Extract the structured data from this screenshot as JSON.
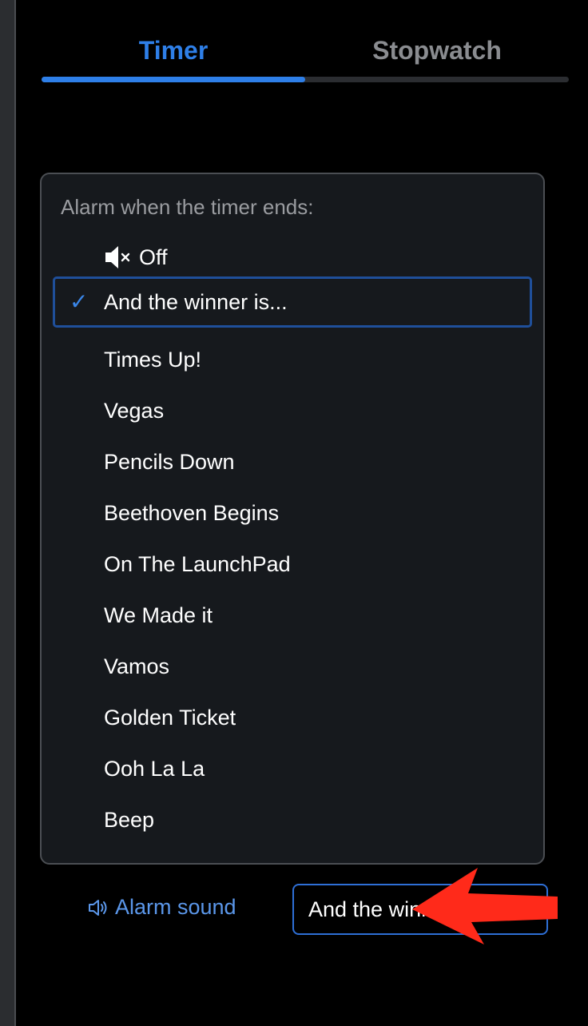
{
  "tabs": {
    "timer": "Timer",
    "stopwatch": "Stopwatch",
    "active": "timer"
  },
  "dropdown": {
    "label": "Alarm when the timer ends:",
    "options": [
      {
        "label": "Off",
        "icon": "muted-speaker-icon"
      },
      {
        "label": "And the winner is...",
        "selected": true
      },
      {
        "label": "Times Up!"
      },
      {
        "label": "Vegas"
      },
      {
        "label": "Pencils Down"
      },
      {
        "label": "Beethoven Begins"
      },
      {
        "label": "On The LaunchPad"
      },
      {
        "label": "We Made it"
      },
      {
        "label": "Vamos"
      },
      {
        "label": "Golden Ticket"
      },
      {
        "label": "Ooh La La"
      },
      {
        "label": "Beep"
      }
    ]
  },
  "alarm": {
    "label": "Alarm sound",
    "icon": "speaker-icon",
    "selected_value": "And the winner is..."
  },
  "colors": {
    "accent": "#2e7fe8",
    "background": "#000000",
    "panel": "#16191d",
    "annotation_arrow": "#ff2a1a"
  }
}
